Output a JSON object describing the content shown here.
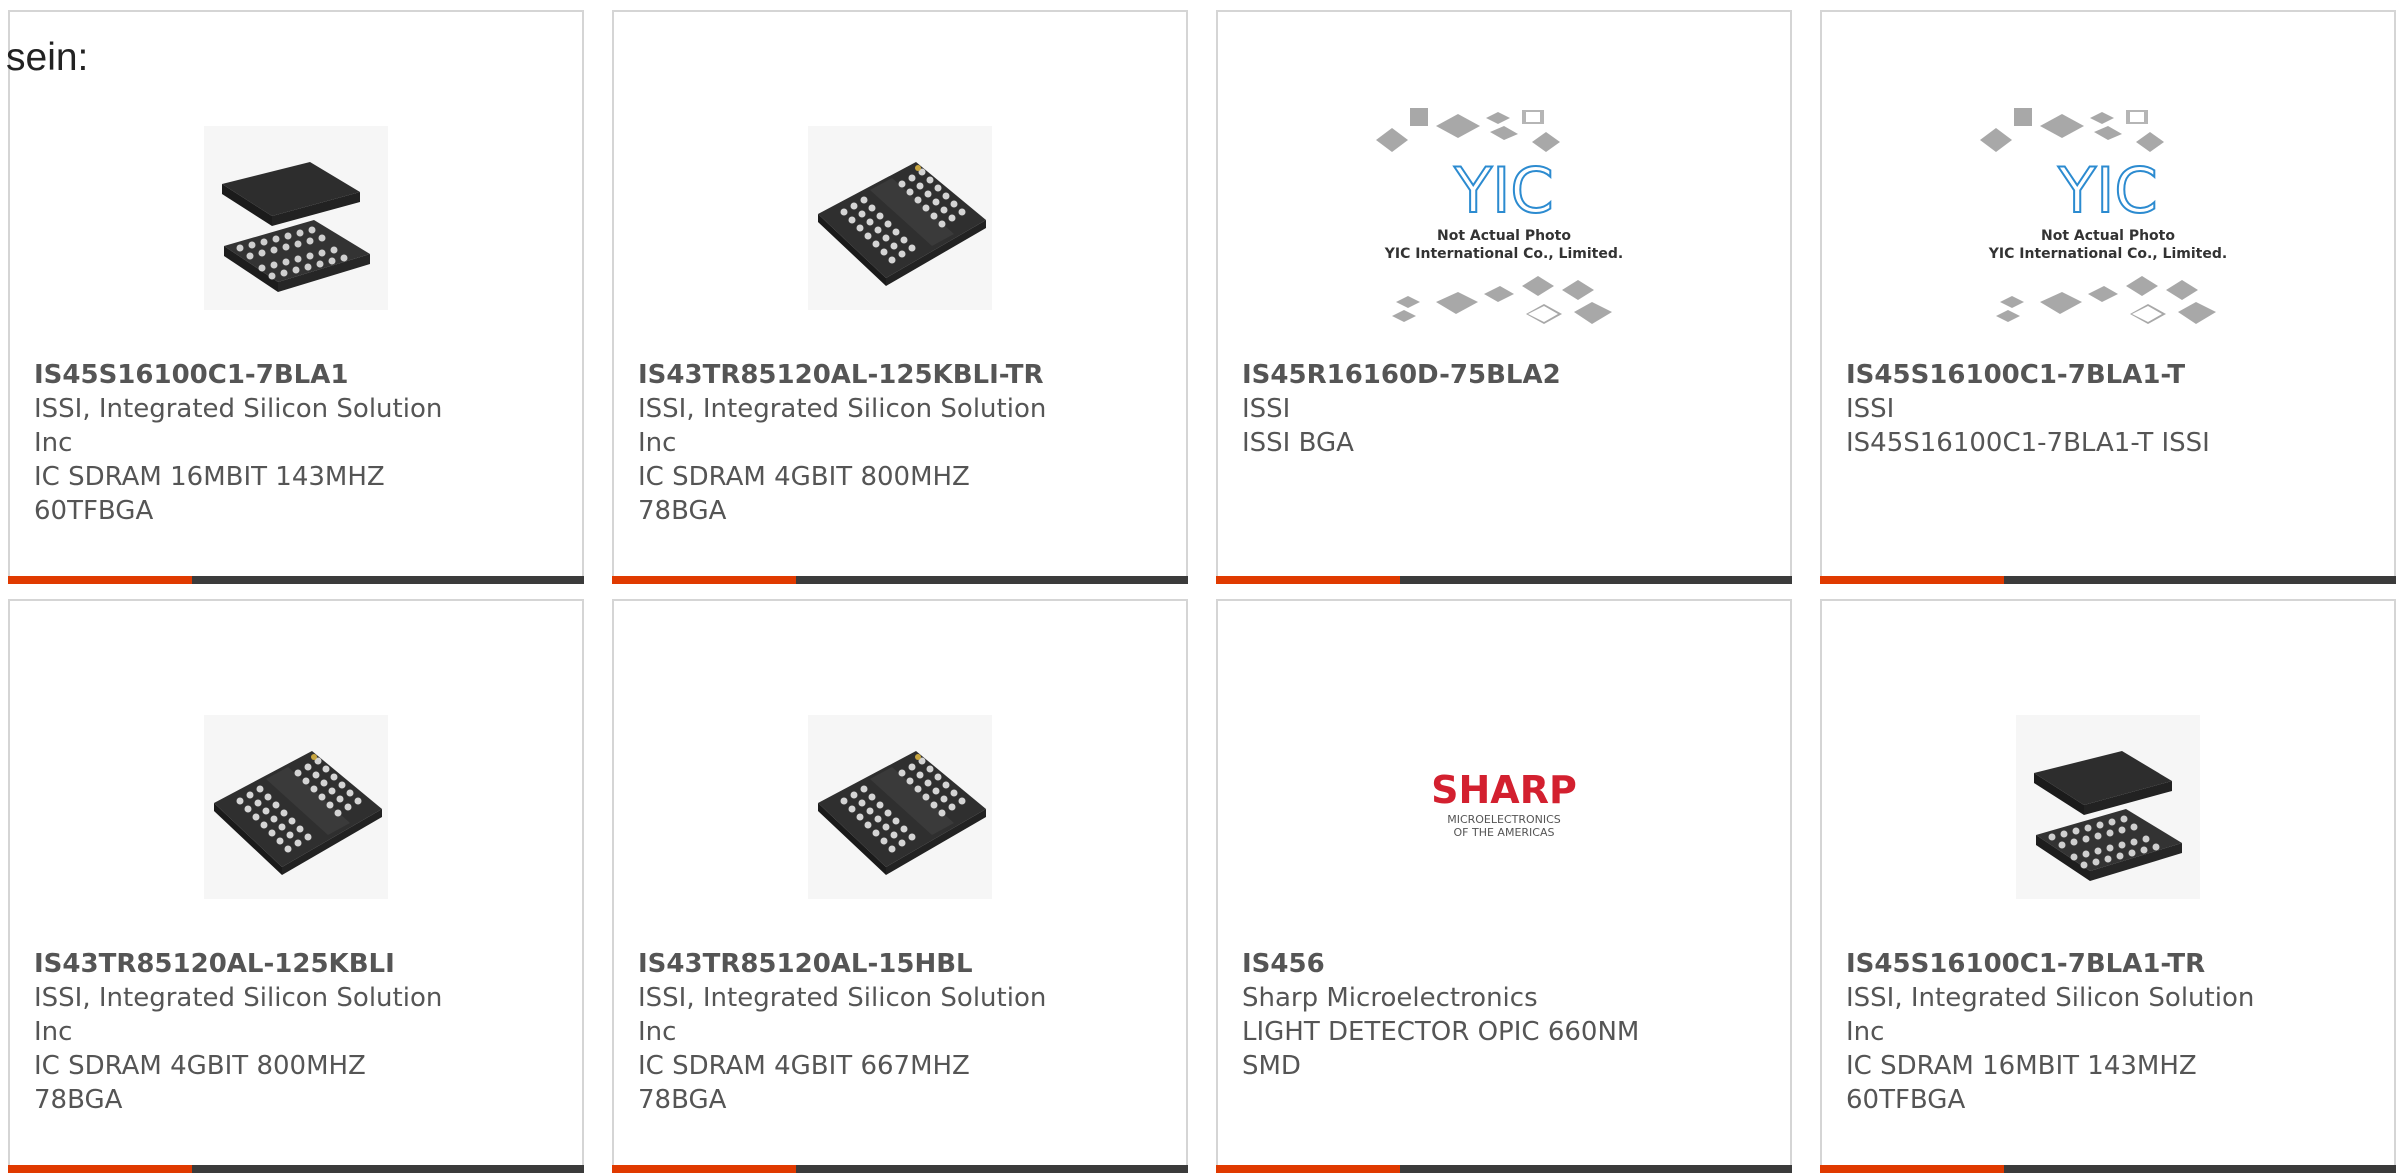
{
  "intro_text": "sein:",
  "colors": {
    "accent_bar": "#e03a00",
    "dark_bar": "#3b3b3b",
    "text": "#555555",
    "card_border": "#d5d5d5",
    "sharp_red": "#d3202f"
  },
  "products": [
    {
      "part_number": "IS45S16100C1-7BLA1",
      "manufacturer": "ISSI, Integrated Silicon Solution Inc",
      "description": "IC SDRAM 16MBIT 143MHZ 60TFBGA",
      "image": "bga-chip-tilted-icon"
    },
    {
      "part_number": "IS43TR85120AL-125KBLI-TR",
      "manufacturer": "ISSI, Integrated Silicon Solution Inc",
      "description": "IC SDRAM 4GBIT 800MHZ 78BGA",
      "image": "bga-chip-top-icon"
    },
    {
      "part_number": "IS45R16160D-75BLA2",
      "manufacturer": "ISSI",
      "description": "ISSI BGA",
      "image": "yic-placeholder-image",
      "image_text": [
        "YIC",
        "Not Actual Photo",
        "YIC International Co., Limited."
      ]
    },
    {
      "part_number": "IS45S16100C1-7BLA1-T",
      "manufacturer": "ISSI",
      "description": "IS45S16100C1-7BLA1-T ISSI",
      "image": "yic-placeholder-image",
      "image_text": [
        "YIC",
        "Not Actual Photo",
        "YIC International Co., Limited."
      ]
    },
    {
      "part_number": "IS43TR85120AL-125KBLI",
      "manufacturer": "ISSI, Integrated Silicon Solution Inc",
      "description": "IC SDRAM 4GBIT 800MHZ 78BGA",
      "image": "bga-chip-top-icon"
    },
    {
      "part_number": "IS43TR85120AL-15HBL",
      "manufacturer": "ISSI, Integrated Silicon Solution Inc",
      "description": "IC SDRAM 4GBIT 667MHZ 78BGA",
      "image": "bga-chip-top-icon"
    },
    {
      "part_number": "IS456",
      "manufacturer": "Sharp Microelectronics",
      "description": "LIGHT DETECTOR OPIC 660NM SMD",
      "image": "sharp-logo-image",
      "image_text": [
        "SHARP",
        "MICROELECTRONICS",
        "OF THE AMERICAS"
      ]
    },
    {
      "part_number": "IS45S16100C1-7BLA1-TR",
      "manufacturer": "ISSI, Integrated Silicon Solution Inc",
      "description": "IC SDRAM 16MBIT 143MHZ 60TFBGA",
      "image": "bga-chip-tilted-icon"
    }
  ]
}
